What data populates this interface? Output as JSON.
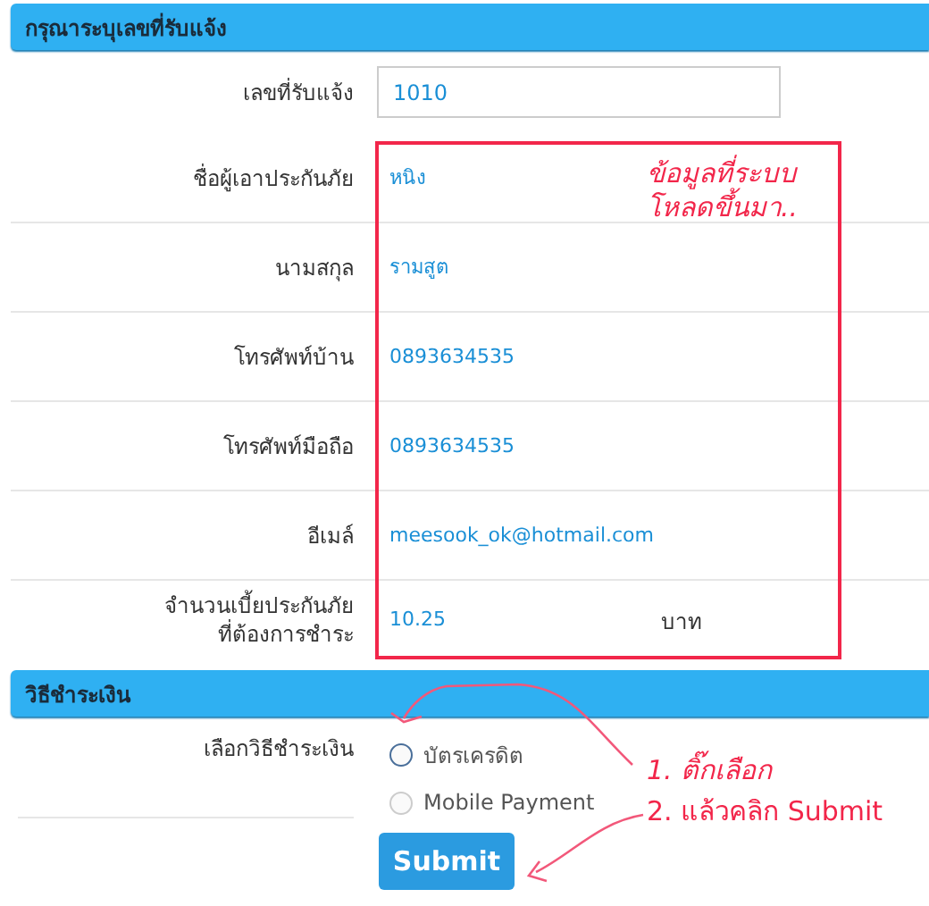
{
  "sections": [
    {
      "title": "กรุณาระบุเลขที่รับแจ้ง",
      "rows": [
        {
          "kind": "input",
          "label": [
            "เลขที่รับแจ้ง"
          ],
          "value": "1010"
        },
        {
          "kind": "value",
          "label": [
            "ชื่อผู้เอาประกันภัย"
          ],
          "value": "หนิง"
        },
        {
          "kind": "value",
          "label": [
            "นามสกุล"
          ],
          "value": "รามสูต"
        },
        {
          "kind": "value",
          "label": [
            "โทรศัพท์บ้าน"
          ],
          "value": "0893634535"
        },
        {
          "kind": "value",
          "label": [
            "โทรศัพท์มือถือ"
          ],
          "value": "0893634535"
        },
        {
          "kind": "value",
          "label": [
            "อีเมล์"
          ],
          "value": "meesook_ok@hotmail.com"
        },
        {
          "kind": "value",
          "label": [
            "จำนวนเบี้ยประกันภัย",
            "ที่ต้องการชำระ"
          ],
          "value": "10.25",
          "unit": "บาท"
        }
      ]
    },
    {
      "title": "วิธีชำระเงิน",
      "rows": [
        {
          "kind": "radio",
          "label": [
            "เลือกวิธีชำระเงิน"
          ],
          "options": [
            {
              "label": "บัตรเครดิต",
              "selected": false
            },
            {
              "label": "Mobile Payment",
              "selected": false
            }
          ]
        }
      ],
      "button": "Submit"
    }
  ],
  "annotations": {
    "box_note": [
      "ข้อมูลที่ระบบ",
      "โหลดขึ้นมา.."
    ],
    "step_1": "1. ติ๊กเลือก",
    "step_2": "2. แล้วคลิก Submit"
  }
}
